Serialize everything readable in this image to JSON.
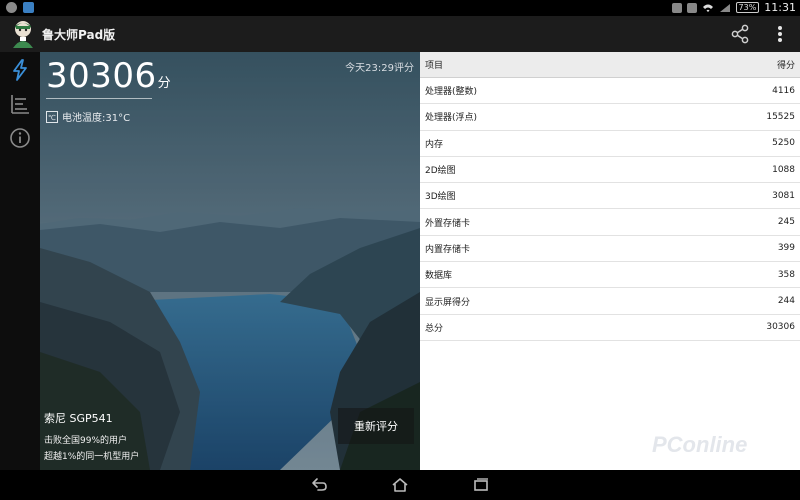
{
  "status_bar": {
    "battery": "73%",
    "time": "11:31"
  },
  "app": {
    "title": "鲁大师Pad版"
  },
  "hero": {
    "score_value": "30306",
    "score_unit": "分",
    "eval_time": "今天23:29评分",
    "battery_temp": "电池温度:31°C",
    "device_name": "索尼 SGP541",
    "beat_text": "击败全国99%的用户",
    "exceed_text": "超越1%的同一机型用户",
    "rescore_label": "重新评分"
  },
  "table": {
    "header_item": "项目",
    "header_score": "得分",
    "rows": [
      {
        "item": "处理器(整数)",
        "score": "4116"
      },
      {
        "item": "处理器(浮点)",
        "score": "15525"
      },
      {
        "item": "内存",
        "score": "5250"
      },
      {
        "item": "2D绘图",
        "score": "1088"
      },
      {
        "item": "3D绘图",
        "score": "3081"
      },
      {
        "item": "外置存储卡",
        "score": "245"
      },
      {
        "item": "内置存储卡",
        "score": "399"
      },
      {
        "item": "数据库",
        "score": "358"
      },
      {
        "item": "显示屏得分",
        "score": "244"
      },
      {
        "item": "总分",
        "score": "30306"
      }
    ]
  },
  "watermark": "PConline",
  "icons": {
    "share": "share-icon",
    "more": "overflow-menu-icon",
    "nav_performance": "lightning-icon",
    "nav_list": "list-icon",
    "nav_info": "info-icon",
    "back": "back-icon",
    "home": "home-icon",
    "recents": "recents-icon"
  },
  "colors": {
    "accent": "#3a8fd8",
    "actionbar": "#1c1c1c",
    "table_header": "#ececec"
  }
}
